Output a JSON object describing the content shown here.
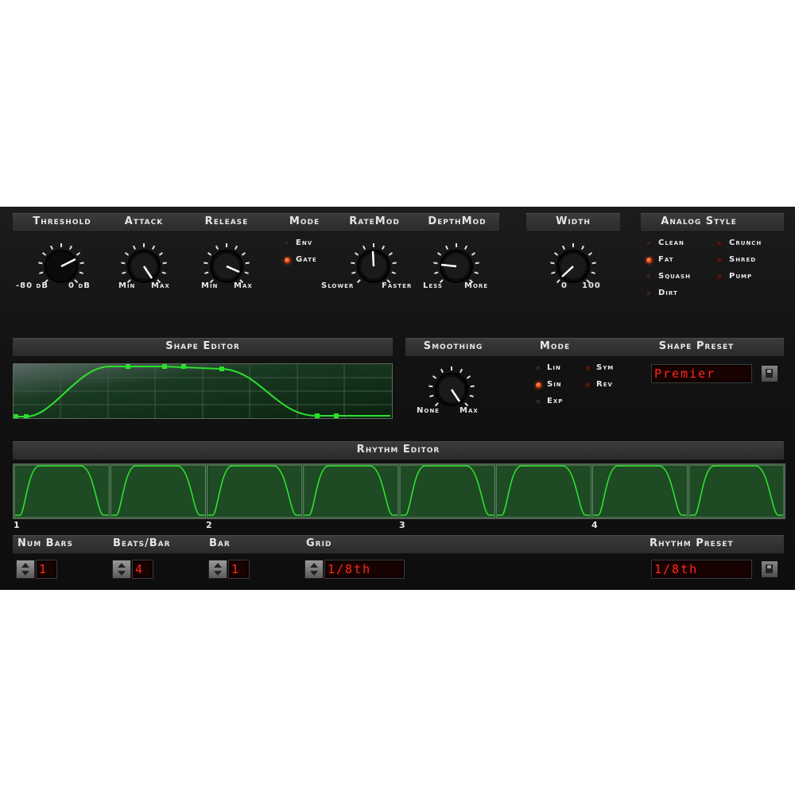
{
  "top_section": {
    "threshold": {
      "label": "Threshold",
      "min": "-80 dB",
      "max": "0 dB"
    },
    "attack": {
      "label": "Attack",
      "min": "Min",
      "max": "Max"
    },
    "release": {
      "label": "Release",
      "min": "Min",
      "max": "Max"
    },
    "mode": {
      "label": "Mode",
      "options": [
        {
          "label": "Env",
          "active": false
        },
        {
          "label": "Gate",
          "active": true
        }
      ]
    },
    "ratemod": {
      "label": "RateMod",
      "min": "Slower",
      "max": "Faster"
    },
    "depthmod": {
      "label": "DepthMod",
      "min": "Less",
      "max": "More"
    },
    "width": {
      "label": "Width",
      "min": "0",
      "max": "100"
    },
    "analog_style": {
      "label": "Analog Style",
      "options": [
        {
          "label": "Clean",
          "active": false
        },
        {
          "label": "Fat",
          "active": true
        },
        {
          "label": "Squash",
          "active": false
        },
        {
          "label": "Dirt",
          "active": false
        },
        {
          "label": "Crunch",
          "active": false
        },
        {
          "label": "Shred",
          "active": false
        },
        {
          "label": "Pump",
          "active": false
        }
      ]
    }
  },
  "shape_section": {
    "editor_label": "Shape Editor",
    "smoothing": {
      "label": "Smoothing",
      "min": "None",
      "max": "Max"
    },
    "mode": {
      "label": "Mode",
      "options": [
        {
          "label": "Lin",
          "active": false
        },
        {
          "label": "Sin",
          "active": true
        },
        {
          "label": "Exp",
          "active": false
        },
        {
          "label": "Sym",
          "active": false
        },
        {
          "label": "Rev",
          "active": false
        }
      ]
    },
    "preset": {
      "label": "Shape Preset",
      "value": "Premier"
    }
  },
  "rhythm_section": {
    "label": "Rhythm Editor",
    "bar_markers": [
      "1",
      "2",
      "3",
      "4"
    ],
    "cells": 8
  },
  "bottom_controls": {
    "num_bars": {
      "label": "Num Bars",
      "value": "1"
    },
    "beats_per_bar": {
      "label": "Beats/Bar",
      "value": "4"
    },
    "bar": {
      "label": "Bar",
      "value": "1"
    },
    "grid": {
      "label": "Grid",
      "value": "1/8th"
    },
    "rhythm_preset": {
      "label": "Rhythm Preset",
      "value": "1/8th"
    }
  },
  "colors": {
    "accent_led": "#e04010",
    "lcd_text": "#ff2a1a",
    "curve": "#2ee02e",
    "editor_bg": "#0b2410"
  }
}
